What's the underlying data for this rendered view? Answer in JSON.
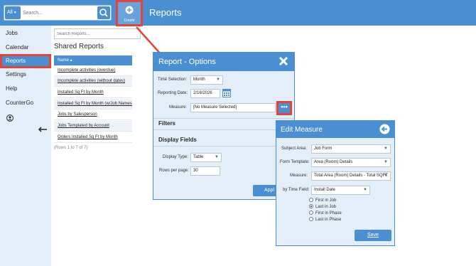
{
  "topbar": {
    "search_scope": "All",
    "search_placeholder": "Search...",
    "create_label": "Create",
    "page_title": "Reports"
  },
  "sidebar": {
    "items": [
      {
        "label": "Jobs"
      },
      {
        "label": "Calendar"
      },
      {
        "label": "Reports"
      },
      {
        "label": "Settings"
      },
      {
        "label": "Help"
      },
      {
        "label": "CounterGo"
      }
    ],
    "active_index": 2,
    "avatar_icon": "user-circle-icon",
    "back_icon": "arrow-left-icon"
  },
  "reports": {
    "search_placeholder": "Search Reports...",
    "title": "Shared Reports",
    "column_header": "Name ▴",
    "rows": [
      "Incomplete activities (overdue)",
      "Incomplete activities (without dates)",
      "Installed Sq Ft by Month",
      "Installed Sq Ft by Month (w/Job Names)",
      "Jobs by Salesperson",
      "Jobs Templated by Account",
      "Orders Installed Sq Ft by Month"
    ],
    "rows_count": "(Rows 1 to 7 of 7)"
  },
  "options": {
    "title": "Report - Options",
    "time_selection_label": "Time Selection:",
    "time_selection_value": "Month",
    "reporting_date_label": "Reporting Date:",
    "reporting_date_value": "2/16/2026",
    "measure_label": "Measure:",
    "measure_value": "[No Measure Selected]",
    "dots_label": "•••",
    "filters_title": "Filters",
    "display_fields_title": "Display Fields",
    "display_type_label": "Display Type:",
    "display_type_value": "Table",
    "rows_per_page_label": "Rows per page:",
    "rows_per_page_value": "30",
    "apply_label": "Appl"
  },
  "edit_measure": {
    "title": "Edit Measure",
    "subject_area_label": "Subject Area:",
    "subject_area_value": "Job Form",
    "form_template_label": "Form Template:",
    "form_template_value": "Area (Room) Details",
    "measure_label": "Measure:",
    "measure_value": "Total Area (Room) Details - Total SQFT",
    "time_field_label": "by Time Field:",
    "time_field_value": "Install Date",
    "radio_options": [
      "First in Job",
      "Last in Job",
      "First in Phase",
      "Last in Phase"
    ],
    "selected_radio_index": 1,
    "save_label": "Save"
  },
  "colors": {
    "brand_blue": "#4a8fd1",
    "highlight_red": "#e2463b",
    "panel_bg": "#e3eef8"
  }
}
